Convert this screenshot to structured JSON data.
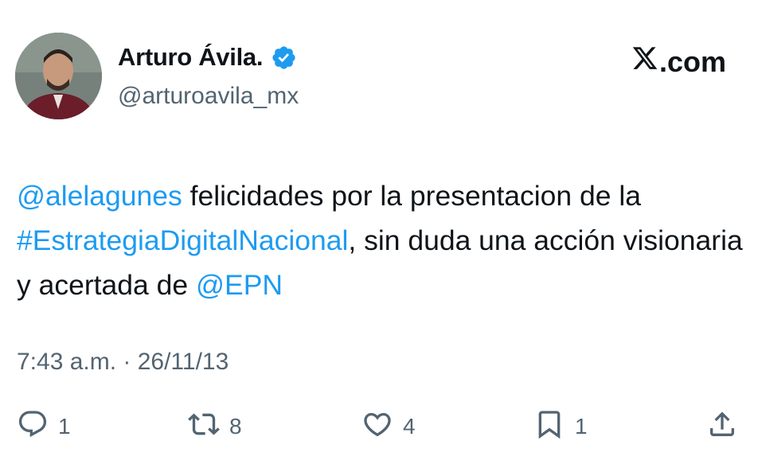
{
  "author": {
    "name": "Arturo Ávila.",
    "handle": "@arturoavila_mx",
    "verified_icon": "verified-badge-icon"
  },
  "brand": {
    "label": ".com",
    "logo_icon": "x-logo-icon"
  },
  "tweet": {
    "mention_1": "@alelagunes",
    "text_1": " felicidades por la presentacion de la ",
    "hashtag": "#EstrategiaDigitalNacional",
    "text_2": ", sin duda una acción visionaria y acertada de ",
    "mention_2": "@EPN"
  },
  "meta": {
    "time": "7:43 a.m. · 26/11/13"
  },
  "actions": {
    "replies": "1",
    "retweets": "8",
    "likes": "4",
    "bookmarks": "1"
  },
  "colors": {
    "link": "#1d9bf0",
    "secondary": "#536471",
    "text": "#0f1419"
  }
}
